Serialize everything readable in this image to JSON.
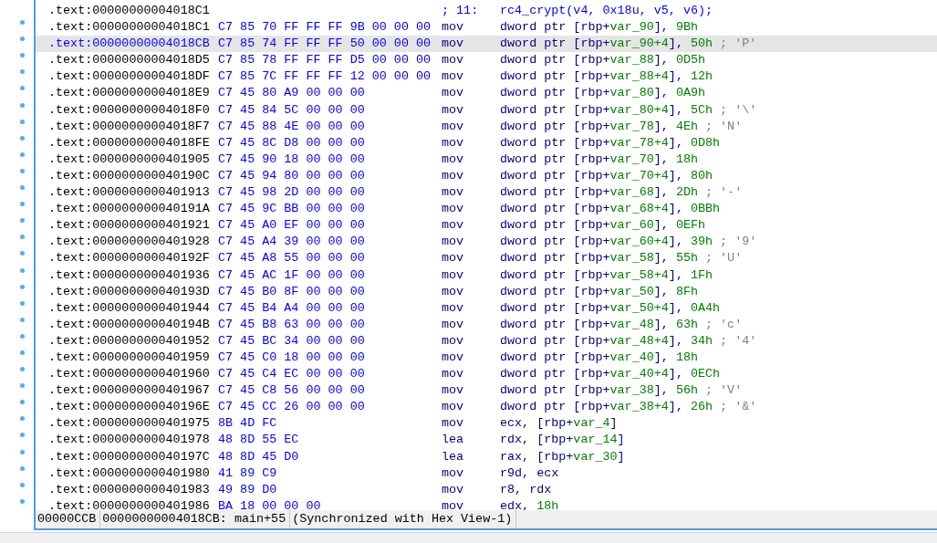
{
  "lines": [
    {
      "kind": "source",
      "marker": false,
      "selected": false,
      "address": ".text:00000000004018C1",
      "line_number": "; 11:",
      "source": "rc4_crypt(v4, 0x18u, v5, v6);"
    },
    {
      "kind": "instruction",
      "marker": true,
      "selected": false,
      "address": ".text:00000000004018C1",
      "bytes": "C7 85 70 FF FF FF 9B 00 00 00",
      "mnemonic": "mov",
      "operands": [
        {
          "kind": "text",
          "text": "dword ptr [rbp+"
        },
        {
          "kind": "value",
          "text": "var_90"
        },
        {
          "kind": "text",
          "text": "], "
        },
        {
          "kind": "value",
          "text": "9Bh"
        }
      ]
    },
    {
      "kind": "instruction",
      "marker": true,
      "selected": true,
      "address": ".text:00000000004018CB",
      "bytes": "C7 85 74 FF FF FF 50 00 00 00",
      "mnemonic": "mov",
      "operands": [
        {
          "kind": "text",
          "text": "dword ptr [rbp+"
        },
        {
          "kind": "value",
          "text": "var_90+4"
        },
        {
          "kind": "text",
          "text": "], "
        },
        {
          "kind": "value",
          "text": "50h"
        }
      ],
      "comment": "; 'P'"
    },
    {
      "kind": "instruction",
      "marker": true,
      "selected": false,
      "address": ".text:00000000004018D5",
      "bytes": "C7 85 78 FF FF FF D5 00 00 00",
      "mnemonic": "mov",
      "operands": [
        {
          "kind": "text",
          "text": "dword ptr [rbp+"
        },
        {
          "kind": "value",
          "text": "var_88"
        },
        {
          "kind": "text",
          "text": "], "
        },
        {
          "kind": "value",
          "text": "0D5h"
        }
      ]
    },
    {
      "kind": "instruction",
      "marker": true,
      "selected": false,
      "address": ".text:00000000004018DF",
      "bytes": "C7 85 7C FF FF FF 12 00 00 00",
      "mnemonic": "mov",
      "operands": [
        {
          "kind": "text",
          "text": "dword ptr [rbp+"
        },
        {
          "kind": "value",
          "text": "var_88+4"
        },
        {
          "kind": "text",
          "text": "], "
        },
        {
          "kind": "value",
          "text": "12h"
        }
      ]
    },
    {
      "kind": "instruction",
      "marker": true,
      "selected": false,
      "address": ".text:00000000004018E9",
      "bytes": "C7 45 80 A9 00 00 00",
      "mnemonic": "mov",
      "operands": [
        {
          "kind": "text",
          "text": "dword ptr [rbp+"
        },
        {
          "kind": "value",
          "text": "var_80"
        },
        {
          "kind": "text",
          "text": "], "
        },
        {
          "kind": "value",
          "text": "0A9h"
        }
      ]
    },
    {
      "kind": "instruction",
      "marker": true,
      "selected": false,
      "address": ".text:00000000004018F0",
      "bytes": "C7 45 84 5C 00 00 00",
      "mnemonic": "mov",
      "operands": [
        {
          "kind": "text",
          "text": "dword ptr [rbp+"
        },
        {
          "kind": "value",
          "text": "var_80+4"
        },
        {
          "kind": "text",
          "text": "], "
        },
        {
          "kind": "value",
          "text": "5Ch"
        }
      ],
      "comment": "; '\\'"
    },
    {
      "kind": "instruction",
      "marker": true,
      "selected": false,
      "address": ".text:00000000004018F7",
      "bytes": "C7 45 88 4E 00 00 00",
      "mnemonic": "mov",
      "operands": [
        {
          "kind": "text",
          "text": "dword ptr [rbp+"
        },
        {
          "kind": "value",
          "text": "var_78"
        },
        {
          "kind": "text",
          "text": "], "
        },
        {
          "kind": "value",
          "text": "4Eh"
        }
      ],
      "comment": "; 'N'"
    },
    {
      "kind": "instruction",
      "marker": true,
      "selected": false,
      "address": ".text:00000000004018FE",
      "bytes": "C7 45 8C D8 00 00 00",
      "mnemonic": "mov",
      "operands": [
        {
          "kind": "text",
          "text": "dword ptr [rbp+"
        },
        {
          "kind": "value",
          "text": "var_78+4"
        },
        {
          "kind": "text",
          "text": "], "
        },
        {
          "kind": "value",
          "text": "0D8h"
        }
      ]
    },
    {
      "kind": "instruction",
      "marker": true,
      "selected": false,
      "address": ".text:0000000000401905",
      "bytes": "C7 45 90 18 00 00 00",
      "mnemonic": "mov",
      "operands": [
        {
          "kind": "text",
          "text": "dword ptr [rbp+"
        },
        {
          "kind": "value",
          "text": "var_70"
        },
        {
          "kind": "text",
          "text": "], "
        },
        {
          "kind": "value",
          "text": "18h"
        }
      ]
    },
    {
      "kind": "instruction",
      "marker": true,
      "selected": false,
      "address": ".text:000000000040190C",
      "bytes": "C7 45 94 80 00 00 00",
      "mnemonic": "mov",
      "operands": [
        {
          "kind": "text",
          "text": "dword ptr [rbp+"
        },
        {
          "kind": "value",
          "text": "var_70+4"
        },
        {
          "kind": "text",
          "text": "], "
        },
        {
          "kind": "value",
          "text": "80h"
        }
      ]
    },
    {
      "kind": "instruction",
      "marker": true,
      "selected": false,
      "address": ".text:0000000000401913",
      "bytes": "C7 45 98 2D 00 00 00",
      "mnemonic": "mov",
      "operands": [
        {
          "kind": "text",
          "text": "dword ptr [rbp+"
        },
        {
          "kind": "value",
          "text": "var_68"
        },
        {
          "kind": "text",
          "text": "], "
        },
        {
          "kind": "value",
          "text": "2Dh"
        }
      ],
      "comment": "; '-'"
    },
    {
      "kind": "instruction",
      "marker": true,
      "selected": false,
      "address": ".text:000000000040191A",
      "bytes": "C7 45 9C BB 00 00 00",
      "mnemonic": "mov",
      "operands": [
        {
          "kind": "text",
          "text": "dword ptr [rbp+"
        },
        {
          "kind": "value",
          "text": "var_68+4"
        },
        {
          "kind": "text",
          "text": "], "
        },
        {
          "kind": "value",
          "text": "0BBh"
        }
      ]
    },
    {
      "kind": "instruction",
      "marker": true,
      "selected": false,
      "address": ".text:0000000000401921",
      "bytes": "C7 45 A0 EF 00 00 00",
      "mnemonic": "mov",
      "operands": [
        {
          "kind": "text",
          "text": "dword ptr [rbp+"
        },
        {
          "kind": "value",
          "text": "var_60"
        },
        {
          "kind": "text",
          "text": "], "
        },
        {
          "kind": "value",
          "text": "0EFh"
        }
      ]
    },
    {
      "kind": "instruction",
      "marker": true,
      "selected": false,
      "address": ".text:0000000000401928",
      "bytes": "C7 45 A4 39 00 00 00",
      "mnemonic": "mov",
      "operands": [
        {
          "kind": "text",
          "text": "dword ptr [rbp+"
        },
        {
          "kind": "value",
          "text": "var_60+4"
        },
        {
          "kind": "text",
          "text": "], "
        },
        {
          "kind": "value",
          "text": "39h"
        }
      ],
      "comment": "; '9'"
    },
    {
      "kind": "instruction",
      "marker": true,
      "selected": false,
      "address": ".text:000000000040192F",
      "bytes": "C7 45 A8 55 00 00 00",
      "mnemonic": "mov",
      "operands": [
        {
          "kind": "text",
          "text": "dword ptr [rbp+"
        },
        {
          "kind": "value",
          "text": "var_58"
        },
        {
          "kind": "text",
          "text": "], "
        },
        {
          "kind": "value",
          "text": "55h"
        }
      ],
      "comment": "; 'U'"
    },
    {
      "kind": "instruction",
      "marker": true,
      "selected": false,
      "address": ".text:0000000000401936",
      "bytes": "C7 45 AC 1F 00 00 00",
      "mnemonic": "mov",
      "operands": [
        {
          "kind": "text",
          "text": "dword ptr [rbp+"
        },
        {
          "kind": "value",
          "text": "var_58+4"
        },
        {
          "kind": "text",
          "text": "], "
        },
        {
          "kind": "value",
          "text": "1Fh"
        }
      ]
    },
    {
      "kind": "instruction",
      "marker": true,
      "selected": false,
      "address": ".text:000000000040193D",
      "bytes": "C7 45 B0 8F 00 00 00",
      "mnemonic": "mov",
      "operands": [
        {
          "kind": "text",
          "text": "dword ptr [rbp+"
        },
        {
          "kind": "value",
          "text": "var_50"
        },
        {
          "kind": "text",
          "text": "], "
        },
        {
          "kind": "value",
          "text": "8Fh"
        }
      ]
    },
    {
      "kind": "instruction",
      "marker": true,
      "selected": false,
      "address": ".text:0000000000401944",
      "bytes": "C7 45 B4 A4 00 00 00",
      "mnemonic": "mov",
      "operands": [
        {
          "kind": "text",
          "text": "dword ptr [rbp+"
        },
        {
          "kind": "value",
          "text": "var_50+4"
        },
        {
          "kind": "text",
          "text": "], "
        },
        {
          "kind": "value",
          "text": "0A4h"
        }
      ]
    },
    {
      "kind": "instruction",
      "marker": true,
      "selected": false,
      "address": ".text:000000000040194B",
      "bytes": "C7 45 B8 63 00 00 00",
      "mnemonic": "mov",
      "operands": [
        {
          "kind": "text",
          "text": "dword ptr [rbp+"
        },
        {
          "kind": "value",
          "text": "var_48"
        },
        {
          "kind": "text",
          "text": "], "
        },
        {
          "kind": "value",
          "text": "63h"
        }
      ],
      "comment": "; 'c'"
    },
    {
      "kind": "instruction",
      "marker": true,
      "selected": false,
      "address": ".text:0000000000401952",
      "bytes": "C7 45 BC 34 00 00 00",
      "mnemonic": "mov",
      "operands": [
        {
          "kind": "text",
          "text": "dword ptr [rbp+"
        },
        {
          "kind": "value",
          "text": "var_48+4"
        },
        {
          "kind": "text",
          "text": "], "
        },
        {
          "kind": "value",
          "text": "34h"
        }
      ],
      "comment": "; '4'"
    },
    {
      "kind": "instruction",
      "marker": true,
      "selected": false,
      "address": ".text:0000000000401959",
      "bytes": "C7 45 C0 18 00 00 00",
      "mnemonic": "mov",
      "operands": [
        {
          "kind": "text",
          "text": "dword ptr [rbp+"
        },
        {
          "kind": "value",
          "text": "var_40"
        },
        {
          "kind": "text",
          "text": "], "
        },
        {
          "kind": "value",
          "text": "18h"
        }
      ]
    },
    {
      "kind": "instruction",
      "marker": true,
      "selected": false,
      "address": ".text:0000000000401960",
      "bytes": "C7 45 C4 EC 00 00 00",
      "mnemonic": "mov",
      "operands": [
        {
          "kind": "text",
          "text": "dword ptr [rbp+"
        },
        {
          "kind": "value",
          "text": "var_40+4"
        },
        {
          "kind": "text",
          "text": "], "
        },
        {
          "kind": "value",
          "text": "0ECh"
        }
      ]
    },
    {
      "kind": "instruction",
      "marker": true,
      "selected": false,
      "address": ".text:0000000000401967",
      "bytes": "C7 45 C8 56 00 00 00",
      "mnemonic": "mov",
      "operands": [
        {
          "kind": "text",
          "text": "dword ptr [rbp+"
        },
        {
          "kind": "value",
          "text": "var_38"
        },
        {
          "kind": "text",
          "text": "], "
        },
        {
          "kind": "value",
          "text": "56h"
        }
      ],
      "comment": "; 'V'"
    },
    {
      "kind": "instruction",
      "marker": true,
      "selected": false,
      "address": ".text:000000000040196E",
      "bytes": "C7 45 CC 26 00 00 00",
      "mnemonic": "mov",
      "operands": [
        {
          "kind": "text",
          "text": "dword ptr [rbp+"
        },
        {
          "kind": "value",
          "text": "var_38+4"
        },
        {
          "kind": "text",
          "text": "], "
        },
        {
          "kind": "value",
          "text": "26h"
        }
      ],
      "comment": "; '&'"
    },
    {
      "kind": "instruction",
      "marker": true,
      "selected": false,
      "address": ".text:0000000000401975",
      "bytes": "8B 4D FC",
      "mnemonic": "mov",
      "operands": [
        {
          "kind": "text",
          "text": "ecx, [rbp+"
        },
        {
          "kind": "value",
          "text": "var_4"
        },
        {
          "kind": "text",
          "text": "]"
        }
      ]
    },
    {
      "kind": "instruction",
      "marker": true,
      "selected": false,
      "address": ".text:0000000000401978",
      "bytes": "48 8D 55 EC",
      "mnemonic": "lea",
      "operands": [
        {
          "kind": "text",
          "text": "rdx, [rbp+"
        },
        {
          "kind": "value",
          "text": "var_14"
        },
        {
          "kind": "text",
          "text": "]"
        }
      ]
    },
    {
      "kind": "instruction",
      "marker": true,
      "selected": false,
      "address": ".text:000000000040197C",
      "bytes": "48 8D 45 D0",
      "mnemonic": "lea",
      "operands": [
        {
          "kind": "text",
          "text": "rax, [rbp+"
        },
        {
          "kind": "value",
          "text": "var_30"
        },
        {
          "kind": "text",
          "text": "]"
        }
      ]
    },
    {
      "kind": "instruction",
      "marker": true,
      "selected": false,
      "address": ".text:0000000000401980",
      "bytes": "41 89 C9",
      "mnemonic": "mov",
      "operands": [
        {
          "kind": "text",
          "text": "r9d, ecx"
        }
      ]
    },
    {
      "kind": "instruction",
      "marker": true,
      "selected": false,
      "address": ".text:0000000000401983",
      "bytes": "49 89 D0",
      "mnemonic": "mov",
      "operands": [
        {
          "kind": "text",
          "text": "r8, rdx"
        }
      ]
    },
    {
      "kind": "instruction",
      "marker": true,
      "selected": false,
      "address": ".text:0000000000401986",
      "bytes": "BA 18 00 00 00",
      "mnemonic": "mov",
      "operands": [
        {
          "kind": "text",
          "text": "edx, "
        },
        {
          "kind": "value",
          "text": "18h"
        }
      ]
    }
  ],
  "status_bar": {
    "fields": [
      "00000CCB",
      "00000000004018CB: main+55",
      "(Synchronized with Hex View-1)"
    ]
  }
}
